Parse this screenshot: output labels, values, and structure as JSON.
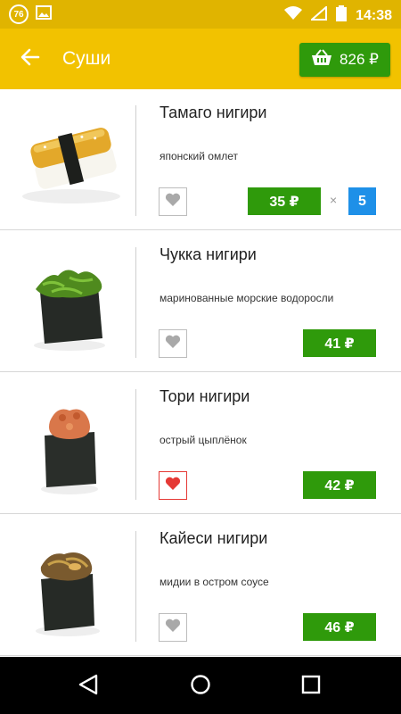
{
  "status_bar": {
    "notification_count": "76",
    "time": "14:38",
    "icons": [
      "image-icon",
      "wifi-icon",
      "signal-icon",
      "battery-icon"
    ]
  },
  "app_bar": {
    "title": "Суши",
    "back_icon": "arrow-left-icon",
    "cart": {
      "icon": "basket-icon",
      "total": "826 ₽"
    }
  },
  "colors": {
    "status_bar": "#e0b400",
    "app_bar": "#f2c200",
    "price_button": "#2f9a0b",
    "quantity_badge": "#1e90e8",
    "favorite_active": "#e53935",
    "favorite_inactive": "#bdbdbd"
  },
  "items": [
    {
      "title": "Тамаго нигири",
      "description": "японский омлет",
      "price": "35 ₽",
      "favorite": false,
      "quantity_separator": "×",
      "quantity": "5"
    },
    {
      "title": "Чукка нигири",
      "description": "маринованные морские водоросли",
      "price": "41 ₽",
      "favorite": false
    },
    {
      "title": "Тори нигири",
      "description": "острый цыплёнок",
      "price": "42 ₽",
      "favorite": true
    },
    {
      "title": "Кайеси нигири",
      "description": "мидии в остром соусе",
      "price": "46 ₽",
      "favorite": false
    }
  ],
  "nav_bar": {
    "buttons": [
      "back-triangle-icon",
      "home-circle-icon",
      "recents-square-icon"
    ]
  }
}
